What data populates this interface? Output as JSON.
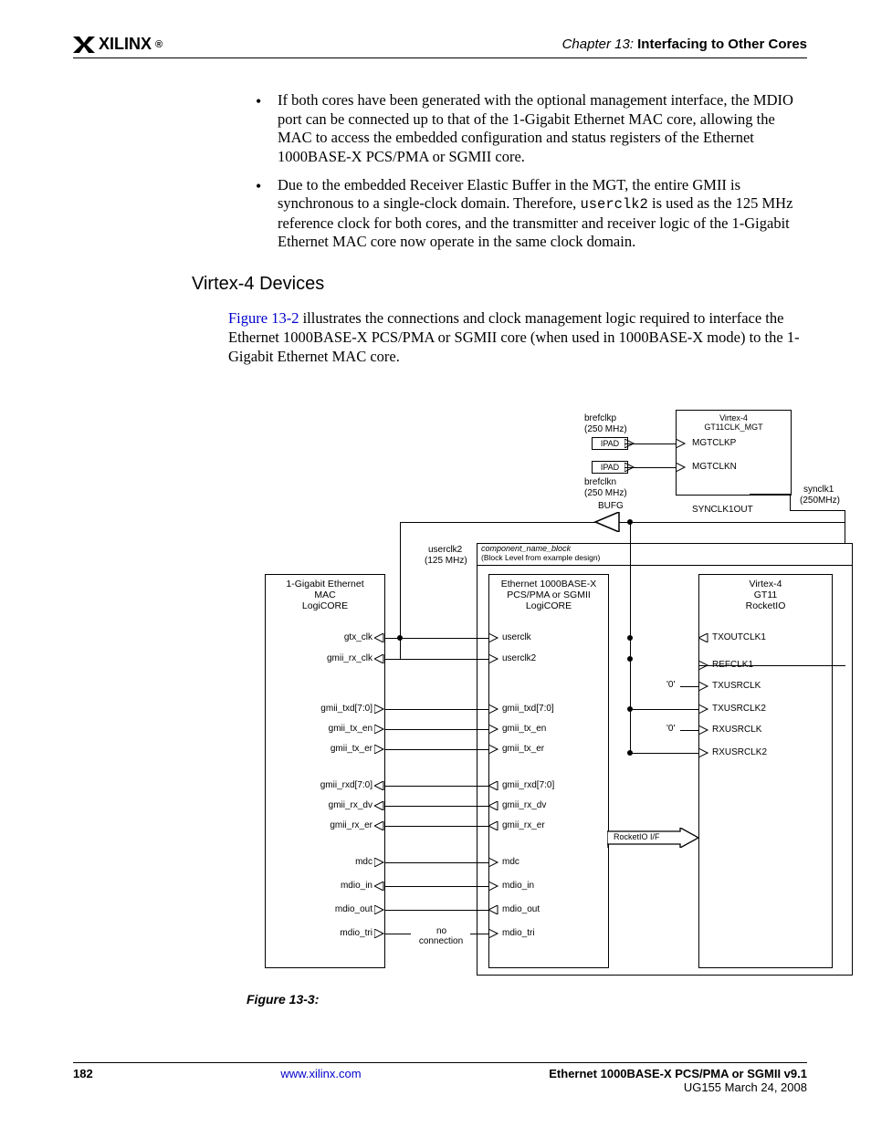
{
  "header": {
    "logo_text": "XILINX",
    "chapter_prefix": "Chapter 13:",
    "chapter_title": "Interfacing to Other Cores"
  },
  "bullets": [
    "If both cores have been generated with the optional management interface, the MDIO port can be connected up to that of the 1-Gigabit Ethernet MAC core, allowing the MAC to access the embedded configuration and status registers of the Ethernet 1000BASE-X PCS/PMA or SGMII core.",
    "Due to the embedded Receiver Elastic Buffer in the MGT, the entire GMII is synchronous to a single-clock domain. Therefore, |userclk2| is used as the 125 MHz reference clock for both cores, and the transmitter and receiver logic of the 1-Gigabit Ethernet MAC core now operate in the same clock domain."
  ],
  "section_heading": "Virtex-4 Devices",
  "body_para": {
    "figref": "Figure 13-2",
    "rest": " illustrates the connections and clock management logic required to interface the Ethernet 1000BASE-X PCS/PMA or SGMII core (when used in 1000BASE-X mode) to the 1-Gigabit Ethernet MAC core."
  },
  "figure_caption": "Figure 13-3:",
  "figure": {
    "mac_title_l1": "1-Gigabit Ethernet",
    "mac_title_l2": "MAC",
    "mac_title_l3": "LogiCORE",
    "pcs_title_l1": "Ethernet 1000BASE-X",
    "pcs_title_l2": "PCS/PMA or SGMII",
    "pcs_title_l3": "LogiCORE",
    "gt_title_l1": "Virtex-4",
    "gt_title_l2": "GT11",
    "gt_title_l3": "RocketIO",
    "gt_top_l1": "Virtex-4",
    "gt_top_l2": "GT11CLK_MGT",
    "brefclkp": "brefclkp",
    "brefclkp_freq": "(250 MHz)",
    "brefclkn": "brefclkn",
    "brefclkn_freq": "(250 MHz)",
    "ipad": "IPAD",
    "mgtclkp": "MGTCLKP",
    "mgtclkn": "MGTCLKN",
    "synclk1out": "SYNCLK1OUT",
    "synclk1": "synclk1",
    "synclk1_freq": "(250MHz)",
    "bufg": "BUFG",
    "userclk2": "userclk2",
    "userclk2_freq": "(125 MHz)",
    "component_name": "component_name_block",
    "component_sub": "(Block Level from example design)",
    "mac_ports": [
      "gtx_clk",
      "gmii_rx_clk",
      "gmii_txd[7:0]",
      "gmii_tx_en",
      "gmii_tx_er",
      "gmii_rxd[7:0]",
      "gmii_rx_dv",
      "gmii_rx_er",
      "mdc",
      "mdio_in",
      "mdio_out",
      "mdio_tri"
    ],
    "pcs_ports_left": [
      "userclk",
      "userclk2",
      "gmii_txd[7:0]",
      "gmii_tx_en",
      "gmii_tx_er",
      "gmii_rxd[7:0]",
      "gmii_rx_dv",
      "gmii_rx_er",
      "mdc",
      "mdio_in",
      "mdio_out",
      "mdio_tri"
    ],
    "gt_ports_left": [
      "TXOUTCLK1",
      "REFCLK1",
      "TXUSRCLK",
      "TXUSRCLK2",
      "RXUSRCLK",
      "RXUSRCLK2"
    ],
    "rocketio_if": "RocketIO I/F",
    "zero": "'0'",
    "no_conn_l1": "no",
    "no_conn_l2": "connection"
  },
  "footer": {
    "page": "182",
    "link": "www.xilinx.com",
    "doc_title": "Ethernet 1000BASE-X PCS/PMA or SGMII v9.1",
    "doc_sub": "UG155 March 24, 2008"
  }
}
